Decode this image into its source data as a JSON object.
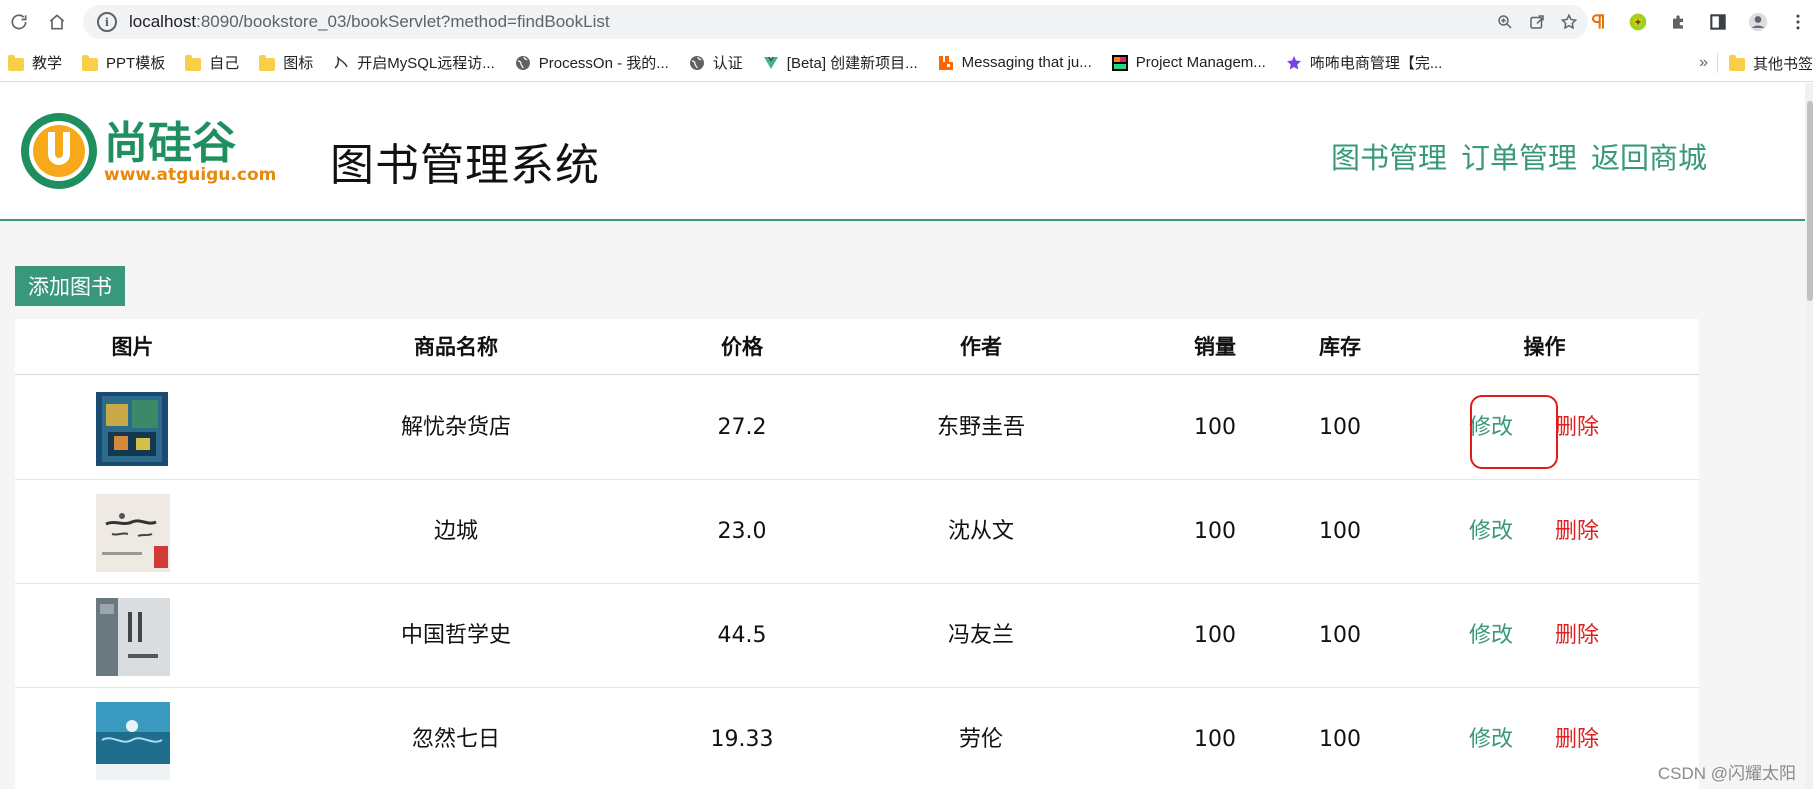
{
  "browser": {
    "url_host": "localhost",
    "url_rest": ":8090/bookstore_03/bookServlet?method=findBookList",
    "bookmarks": [
      {
        "label": "教学",
        "icon": "folder-icon"
      },
      {
        "label": "PPT模板",
        "icon": "folder-icon"
      },
      {
        "label": "自己",
        "icon": "folder-icon"
      },
      {
        "label": "图标",
        "icon": "folder-icon"
      },
      {
        "label": "开启MySQL远程访...",
        "icon": "mysql-icon"
      },
      {
        "label": "ProcessOn - 我的...",
        "icon": "globe-icon"
      },
      {
        "label": "认证",
        "icon": "globe-icon"
      },
      {
        "label": "[Beta] 创建新项目...",
        "icon": "vue-icon"
      },
      {
        "label": "Messaging that ju...",
        "icon": "rabbitmq-icon"
      },
      {
        "label": "Project Managem...",
        "icon": "jetbrains-icon"
      },
      {
        "label": "咘咘电商管理【完...",
        "icon": "star-icon"
      }
    ],
    "bookmarks_more": "»",
    "other_bookmarks": "其他书签"
  },
  "header": {
    "logo_brand": "尚硅谷",
    "logo_url": "www.atguigu.com",
    "system_title": "图书管理系统",
    "nav": [
      "图书管理",
      "订单管理",
      "返回商城"
    ]
  },
  "actions": {
    "add_book": "添加图书"
  },
  "table": {
    "columns": [
      "图片",
      "商品名称",
      "价格",
      "作者",
      "销量",
      "库存",
      "操作"
    ],
    "rows": [
      {
        "name": "解忧杂货店",
        "price": "27.2",
        "author": "东野圭吾",
        "sales": "100",
        "stock": "100",
        "cover": "cover-blue-book"
      },
      {
        "name": "边城",
        "price": "23.0",
        "author": "沈从文",
        "sales": "100",
        "stock": "100",
        "cover": "cover-ink-painting"
      },
      {
        "name": "中国哲学史",
        "price": "44.5",
        "author": "冯友兰",
        "sales": "100",
        "stock": "100",
        "cover": "cover-grey-book"
      },
      {
        "name": "忽然七日",
        "price": "19.33",
        "author": "劳伦",
        "sales": "100",
        "stock": "100",
        "cover": "cover-underwater"
      }
    ],
    "edit_label": "修改",
    "delete_label": "删除"
  },
  "colors": {
    "accent": "#39987c",
    "delete": "#e02020",
    "highlight": "#e11a1a"
  },
  "watermark": "CSDN @闪耀太阳"
}
